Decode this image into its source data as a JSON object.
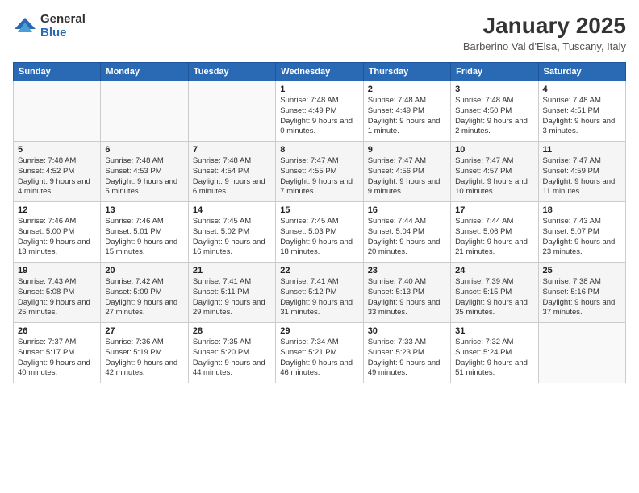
{
  "logo": {
    "general": "General",
    "blue": "Blue"
  },
  "title": "January 2025",
  "subtitle": "Barberino Val d'Elsa, Tuscany, Italy",
  "weekdays": [
    "Sunday",
    "Monday",
    "Tuesday",
    "Wednesday",
    "Thursday",
    "Friday",
    "Saturday"
  ],
  "weeks": [
    [
      {
        "day": "",
        "sunrise": "",
        "sunset": "",
        "daylight": ""
      },
      {
        "day": "",
        "sunrise": "",
        "sunset": "",
        "daylight": ""
      },
      {
        "day": "",
        "sunrise": "",
        "sunset": "",
        "daylight": ""
      },
      {
        "day": "1",
        "sunrise": "Sunrise: 7:48 AM",
        "sunset": "Sunset: 4:49 PM",
        "daylight": "Daylight: 9 hours and 0 minutes."
      },
      {
        "day": "2",
        "sunrise": "Sunrise: 7:48 AM",
        "sunset": "Sunset: 4:49 PM",
        "daylight": "Daylight: 9 hours and 1 minute."
      },
      {
        "day": "3",
        "sunrise": "Sunrise: 7:48 AM",
        "sunset": "Sunset: 4:50 PM",
        "daylight": "Daylight: 9 hours and 2 minutes."
      },
      {
        "day": "4",
        "sunrise": "Sunrise: 7:48 AM",
        "sunset": "Sunset: 4:51 PM",
        "daylight": "Daylight: 9 hours and 3 minutes."
      }
    ],
    [
      {
        "day": "5",
        "sunrise": "Sunrise: 7:48 AM",
        "sunset": "Sunset: 4:52 PM",
        "daylight": "Daylight: 9 hours and 4 minutes."
      },
      {
        "day": "6",
        "sunrise": "Sunrise: 7:48 AM",
        "sunset": "Sunset: 4:53 PM",
        "daylight": "Daylight: 9 hours and 5 minutes."
      },
      {
        "day": "7",
        "sunrise": "Sunrise: 7:48 AM",
        "sunset": "Sunset: 4:54 PM",
        "daylight": "Daylight: 9 hours and 6 minutes."
      },
      {
        "day": "8",
        "sunrise": "Sunrise: 7:47 AM",
        "sunset": "Sunset: 4:55 PM",
        "daylight": "Daylight: 9 hours and 7 minutes."
      },
      {
        "day": "9",
        "sunrise": "Sunrise: 7:47 AM",
        "sunset": "Sunset: 4:56 PM",
        "daylight": "Daylight: 9 hours and 9 minutes."
      },
      {
        "day": "10",
        "sunrise": "Sunrise: 7:47 AM",
        "sunset": "Sunset: 4:57 PM",
        "daylight": "Daylight: 9 hours and 10 minutes."
      },
      {
        "day": "11",
        "sunrise": "Sunrise: 7:47 AM",
        "sunset": "Sunset: 4:59 PM",
        "daylight": "Daylight: 9 hours and 11 minutes."
      }
    ],
    [
      {
        "day": "12",
        "sunrise": "Sunrise: 7:46 AM",
        "sunset": "Sunset: 5:00 PM",
        "daylight": "Daylight: 9 hours and 13 minutes."
      },
      {
        "day": "13",
        "sunrise": "Sunrise: 7:46 AM",
        "sunset": "Sunset: 5:01 PM",
        "daylight": "Daylight: 9 hours and 15 minutes."
      },
      {
        "day": "14",
        "sunrise": "Sunrise: 7:45 AM",
        "sunset": "Sunset: 5:02 PM",
        "daylight": "Daylight: 9 hours and 16 minutes."
      },
      {
        "day": "15",
        "sunrise": "Sunrise: 7:45 AM",
        "sunset": "Sunset: 5:03 PM",
        "daylight": "Daylight: 9 hours and 18 minutes."
      },
      {
        "day": "16",
        "sunrise": "Sunrise: 7:44 AM",
        "sunset": "Sunset: 5:04 PM",
        "daylight": "Daylight: 9 hours and 20 minutes."
      },
      {
        "day": "17",
        "sunrise": "Sunrise: 7:44 AM",
        "sunset": "Sunset: 5:06 PM",
        "daylight": "Daylight: 9 hours and 21 minutes."
      },
      {
        "day": "18",
        "sunrise": "Sunrise: 7:43 AM",
        "sunset": "Sunset: 5:07 PM",
        "daylight": "Daylight: 9 hours and 23 minutes."
      }
    ],
    [
      {
        "day": "19",
        "sunrise": "Sunrise: 7:43 AM",
        "sunset": "Sunset: 5:08 PM",
        "daylight": "Daylight: 9 hours and 25 minutes."
      },
      {
        "day": "20",
        "sunrise": "Sunrise: 7:42 AM",
        "sunset": "Sunset: 5:09 PM",
        "daylight": "Daylight: 9 hours and 27 minutes."
      },
      {
        "day": "21",
        "sunrise": "Sunrise: 7:41 AM",
        "sunset": "Sunset: 5:11 PM",
        "daylight": "Daylight: 9 hours and 29 minutes."
      },
      {
        "day": "22",
        "sunrise": "Sunrise: 7:41 AM",
        "sunset": "Sunset: 5:12 PM",
        "daylight": "Daylight: 9 hours and 31 minutes."
      },
      {
        "day": "23",
        "sunrise": "Sunrise: 7:40 AM",
        "sunset": "Sunset: 5:13 PM",
        "daylight": "Daylight: 9 hours and 33 minutes."
      },
      {
        "day": "24",
        "sunrise": "Sunrise: 7:39 AM",
        "sunset": "Sunset: 5:15 PM",
        "daylight": "Daylight: 9 hours and 35 minutes."
      },
      {
        "day": "25",
        "sunrise": "Sunrise: 7:38 AM",
        "sunset": "Sunset: 5:16 PM",
        "daylight": "Daylight: 9 hours and 37 minutes."
      }
    ],
    [
      {
        "day": "26",
        "sunrise": "Sunrise: 7:37 AM",
        "sunset": "Sunset: 5:17 PM",
        "daylight": "Daylight: 9 hours and 40 minutes."
      },
      {
        "day": "27",
        "sunrise": "Sunrise: 7:36 AM",
        "sunset": "Sunset: 5:19 PM",
        "daylight": "Daylight: 9 hours and 42 minutes."
      },
      {
        "day": "28",
        "sunrise": "Sunrise: 7:35 AM",
        "sunset": "Sunset: 5:20 PM",
        "daylight": "Daylight: 9 hours and 44 minutes."
      },
      {
        "day": "29",
        "sunrise": "Sunrise: 7:34 AM",
        "sunset": "Sunset: 5:21 PM",
        "daylight": "Daylight: 9 hours and 46 minutes."
      },
      {
        "day": "30",
        "sunrise": "Sunrise: 7:33 AM",
        "sunset": "Sunset: 5:23 PM",
        "daylight": "Daylight: 9 hours and 49 minutes."
      },
      {
        "day": "31",
        "sunrise": "Sunrise: 7:32 AM",
        "sunset": "Sunset: 5:24 PM",
        "daylight": "Daylight: 9 hours and 51 minutes."
      },
      {
        "day": "",
        "sunrise": "",
        "sunset": "",
        "daylight": ""
      }
    ]
  ]
}
